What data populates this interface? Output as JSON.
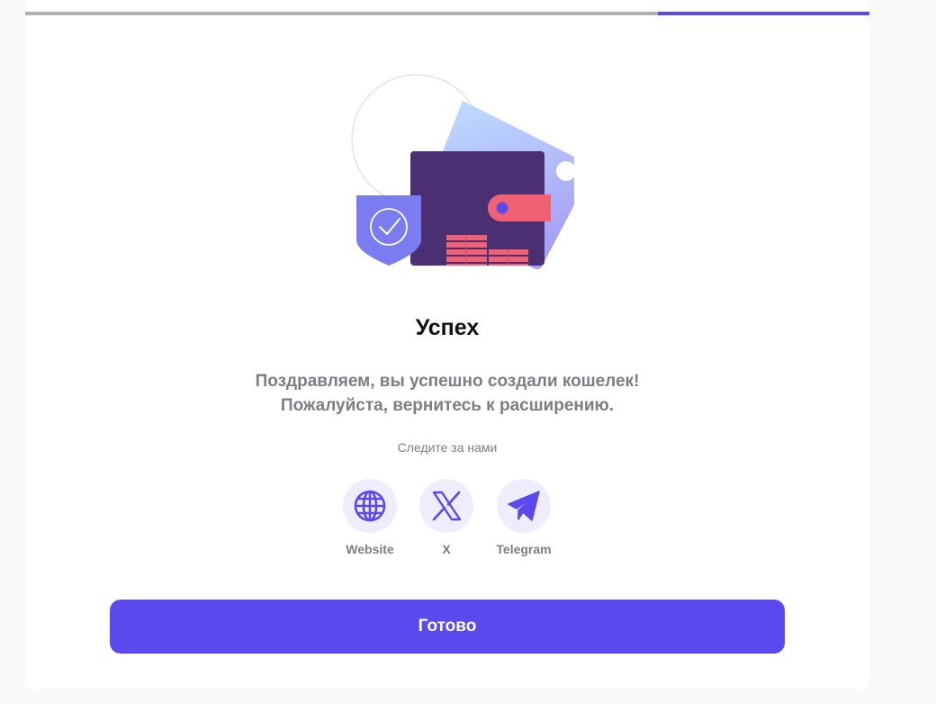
{
  "progress": {
    "fraction": 0.25
  },
  "success": {
    "title": "Успех",
    "message_line1": "Поздравляем, вы успешно создали кошелек!",
    "message_line2": "Пожалуйста, вернитесь к расширению."
  },
  "follow": {
    "label": "Следите за нами",
    "links": [
      {
        "label": "Website",
        "icon": "globe-icon"
      },
      {
        "label": "X",
        "icon": "x-logo-icon"
      },
      {
        "label": "Telegram",
        "icon": "telegram-icon"
      }
    ]
  },
  "done_button": {
    "label": "Готово"
  },
  "colors": {
    "accent": "#5b49ee",
    "icon_bg": "#eeedfd",
    "muted_text": "#7d7d83",
    "wallet": "#4a2f72",
    "coin": "#f06273",
    "card_gradient_top": "#bfe0ff",
    "card_gradient_bottom": "#a79ef6",
    "shield": "#7b7cf0"
  }
}
